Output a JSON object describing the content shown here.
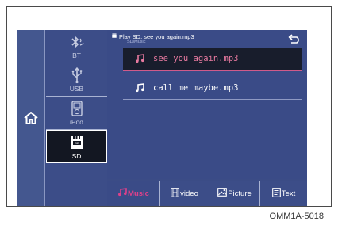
{
  "screen": {
    "home": {
      "icon": "home-icon"
    },
    "sources": [
      {
        "id": "bt",
        "label": "BT",
        "icon": "bluetooth-icon"
      },
      {
        "id": "usb",
        "label": "USB",
        "icon": "usb-icon"
      },
      {
        "id": "ipod",
        "label": "iPod",
        "icon": "ipod-icon"
      },
      {
        "id": "sd",
        "label": "SD",
        "icon": "sd-card-icon",
        "active": true
      }
    ],
    "now_playing": {
      "title": "Play SD: see you again.mp3",
      "path": "SD\\Music"
    },
    "tracks": [
      {
        "name": "see you again.mp3",
        "selected": true
      },
      {
        "name": "call me maybe.mp3",
        "selected": false
      }
    ],
    "tabs": [
      {
        "label": "Music",
        "icon": "music-note-icon",
        "active": true
      },
      {
        "label": "video",
        "icon": "film-icon",
        "active": false
      },
      {
        "label": "Picture",
        "icon": "picture-icon",
        "active": false
      },
      {
        "label": "Text",
        "icon": "text-doc-icon",
        "active": false
      }
    ]
  },
  "caption": "OMM1A-5018",
  "colors": {
    "background": "#3b4c86",
    "active_source": "#131722",
    "selected_track_text": "#e87aa0",
    "active_tab_text": "#e0408a"
  }
}
